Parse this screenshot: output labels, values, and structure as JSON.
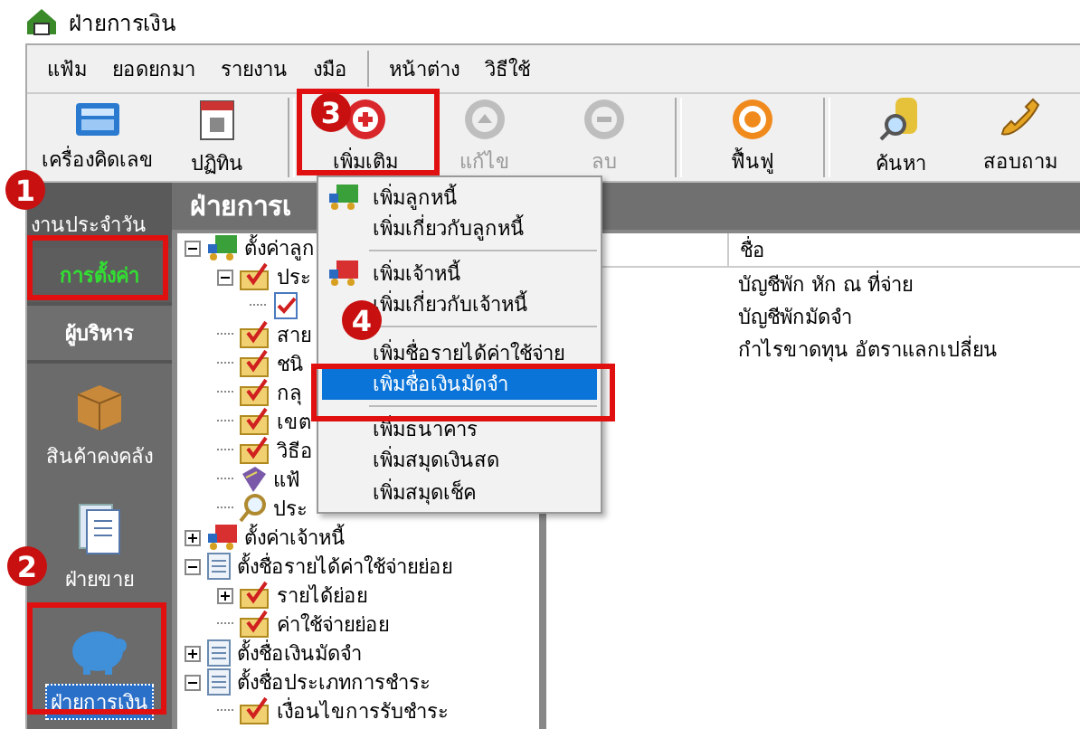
{
  "window": {
    "title": "ฝ่ายการเงิน"
  },
  "menu_bar": [
    "แฟ้ม",
    "ยอดยกมา",
    "รายงาน",
    "งมือ",
    "หน้าต่าง",
    "วิธีใช้"
  ],
  "toolbar": [
    {
      "label": "เครื่องคิดเลข",
      "disabled": false
    },
    {
      "label": "ปฏิทิน",
      "disabled": false
    },
    {
      "label": "เพิ่มเติม",
      "disabled": false
    },
    {
      "label": "แก้ไข",
      "disabled": true
    },
    {
      "label": "ลบ",
      "disabled": true
    },
    {
      "label": "ฟื้นฟู",
      "disabled": false
    },
    {
      "label": "ค้นหา",
      "disabled": false
    },
    {
      "label": "สอบถาม",
      "disabled": false
    }
  ],
  "sidebar": {
    "header": "งานประจำวัน",
    "tabs": [
      {
        "label": "การตั้งค่า",
        "selected": true
      },
      {
        "label": "ผู้บริหาร",
        "selected": false
      }
    ],
    "modules": [
      {
        "label": "สินค้าคงคลัง",
        "selected": false
      },
      {
        "label": "ฝ่ายขาย",
        "selected": false
      },
      {
        "label": "ฝ่ายการเงิน",
        "selected": true
      }
    ]
  },
  "panel": {
    "title": "ฝ่ายการเ",
    "tree": [
      {
        "label": "ตั้งค่าลูก",
        "kind": "truck",
        "expanded": true,
        "children": [
          {
            "label": "ประ",
            "kind": "folder",
            "expanded": true,
            "children": [
              {
                "kind": "doc"
              }
            ]
          },
          {
            "label": "สาย",
            "kind": "folder"
          },
          {
            "label": "ชนิ",
            "kind": "folder"
          },
          {
            "label": "กลุ",
            "kind": "folder"
          },
          {
            "label": "เขต",
            "kind": "folder"
          },
          {
            "label": "วิธีอ",
            "kind": "folder"
          },
          {
            "label": "แฟ้",
            "kind": "book"
          },
          {
            "label": "ประ",
            "kind": "search"
          }
        ]
      },
      {
        "label": "ตั้งค่าเจ้าหนี้",
        "kind": "truck2",
        "expanded": false
      },
      {
        "label": "ตั้งชื่อรายได้ค่าใช้จ่ายย่อย",
        "kind": "page",
        "expanded": true,
        "children": [
          {
            "label": "รายได้ย่อย",
            "kind": "folder",
            "expanded": false
          },
          {
            "label": "ค่าใช้จ่ายย่อย",
            "kind": "folder"
          }
        ]
      },
      {
        "label": "ตั้งชื่อเงินมัดจำ",
        "kind": "page",
        "expanded": false
      },
      {
        "label": "ตั้งชื่อประเภทการชำระ",
        "kind": "page",
        "expanded": true,
        "children": [
          {
            "label": "เงื่อนไขการรับชำระ",
            "kind": "folder"
          }
        ]
      }
    ],
    "list": {
      "columns": [
        "ชื่อ"
      ],
      "rows": [
        "บัญชีพัก หัก ณ ที่จ่าย",
        "บัญชีพักมัดจำ",
        "กำไรขาดทุน อัตราแลกเปลี่ยน"
      ]
    }
  },
  "context_menu": [
    {
      "label": "เพิ่มลูกหนี้",
      "kind": "truck",
      "selected": false
    },
    {
      "label": "เพิ่มเกี่ยวกับลูกหนี้",
      "kind": "plain",
      "selected": false
    },
    {
      "kind": "separator"
    },
    {
      "label": "เพิ่มเจ้าหนี้",
      "kind": "truck2",
      "selected": false
    },
    {
      "label": "เพิ่มเกี่ยวกับเจ้าหนี้",
      "kind": "plain",
      "selected": false
    },
    {
      "kind": "separator"
    },
    {
      "label": "เพิ่มชื่อรายได้ค่าใช้จ่าย",
      "kind": "plain",
      "selected": false
    },
    {
      "label": "เพิ่มชื่อเงินมัดจำ",
      "kind": "plain",
      "selected": true
    },
    {
      "kind": "separator"
    },
    {
      "label": "เพิ่มธนาคาร",
      "kind": "plain",
      "selected": false
    },
    {
      "label": "เพิ่มสมุดเงินสด",
      "kind": "plain",
      "selected": false
    },
    {
      "label": "เพิ่มสมุดเช็ค",
      "kind": "plain",
      "selected": false
    }
  ],
  "annotations": [
    "1",
    "2",
    "3",
    "4"
  ]
}
